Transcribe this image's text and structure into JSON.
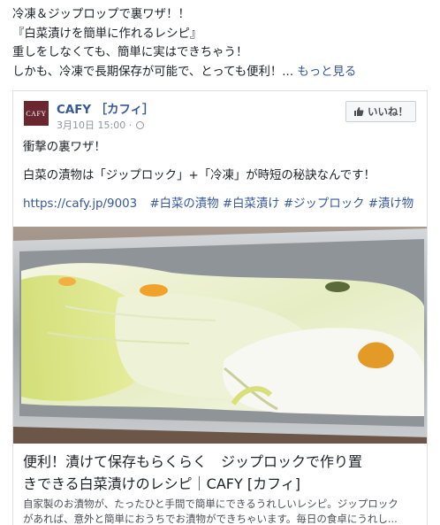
{
  "post": {
    "text_lines": [
      "冷凍＆ジップロップで裏ワザ！！",
      "『白菜漬けを簡単に作れるレシピ』",
      "重しをしなくても、簡単に実はできちゃう！",
      "しかも、冷凍で長期保存が可能で、とっても便利！..."
    ],
    "see_more": "もっと見る"
  },
  "card": {
    "page_logo": "CAFY",
    "page_name": "CAFY ［カフィ］",
    "date": "3月10日 15:00 ·",
    "like_label": "いいね！",
    "body_line1": "衝撃の裏ワザ！",
    "body_line2": "白菜の漬物は「ジップロック」+「冷凍」が時短の秘訣なんです！",
    "url": "https://cafy.jp/9003",
    "hashtags": [
      "#白菜の漬物",
      "#白菜漬け",
      "#ジップロック",
      "#漬け物"
    ],
    "link_title_lines": [
      "便利！漬けて保存もらくらく　ジップロックで作り置",
      "きできる白菜漬けのレシピ｜CAFY [カフィ]"
    ],
    "link_desc_lines": [
      "自家製のお漬物が、たったひと手間で簡単にできるうれしいレシピ。ジップロック",
      "があれば、意外と簡単におうちでお漬物ができちゃいます。毎日の食卓にうれし..."
    ]
  },
  "colors": {
    "link_blue": "#365899",
    "text": "#1d2129",
    "meta_gray": "#90949c",
    "logo_bg": "#6b2730"
  }
}
